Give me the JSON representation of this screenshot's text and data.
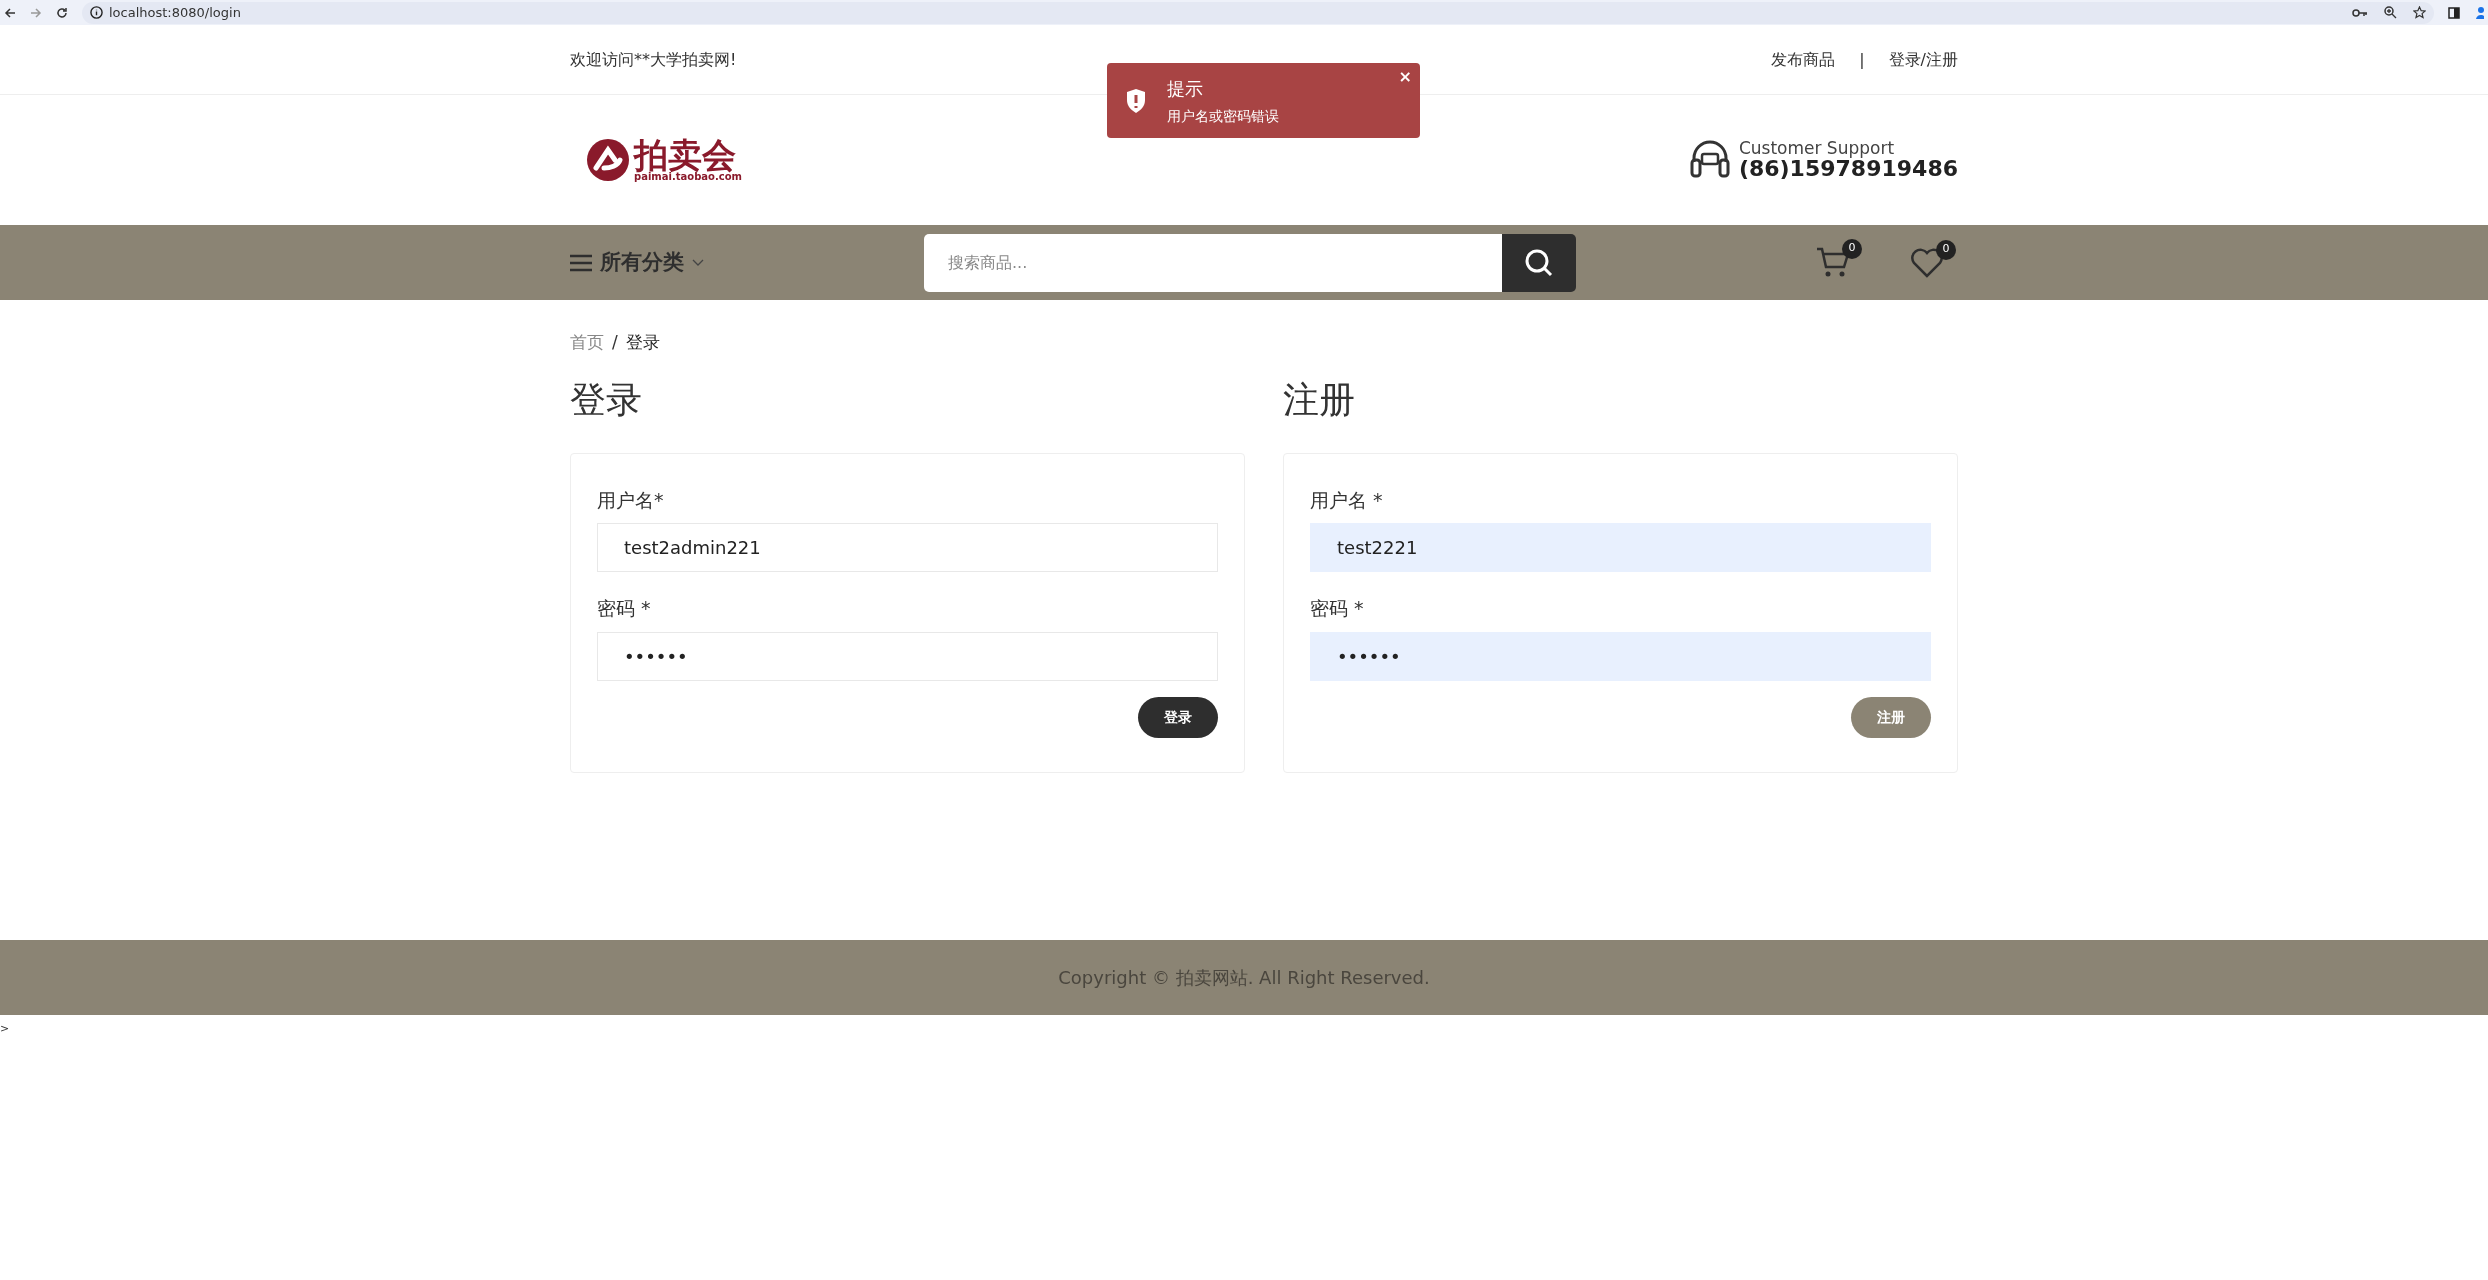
{
  "browser": {
    "url": "localhost:8080/login"
  },
  "top_bar": {
    "welcome": "欢迎访问**大学拍卖网!",
    "links": [
      {
        "label": "发布商品"
      },
      {
        "label": "登录/注册"
      }
    ],
    "separator": "|"
  },
  "toast": {
    "title": "提示",
    "message": "用户名或密码错误",
    "close": "×"
  },
  "header": {
    "logo": {
      "name": "拍卖会",
      "domain": "paimai.taobao.com"
    },
    "support": {
      "label": "Customer Support",
      "phone": "(86)15978919486"
    }
  },
  "nav": {
    "menu_label": "所有分类",
    "search": {
      "placeholder": "搜索商品..."
    },
    "cart_count": "0",
    "wishlist_count": "0"
  },
  "breadcrumb": [
    {
      "label": "首页",
      "selected": false
    },
    {
      "label": "登录",
      "selected": true
    }
  ],
  "breadcrumb_separator": "/",
  "forms": [
    {
      "title": "登录",
      "fields": [
        {
          "label": "用户名*",
          "value": "test2admin221",
          "autofilled": false
        },
        {
          "label": "密码 *",
          "value": "••••••",
          "autofilled": false
        }
      ],
      "button": {
        "label": "登录",
        "hovered": true
      }
    },
    {
      "title": "注册",
      "fields": [
        {
          "label": "用户名 *",
          "value": "test2221",
          "autofilled": true
        },
        {
          "label": "密码 *",
          "value": "••••••",
          "autofilled": true
        }
      ],
      "button": {
        "label": "注册",
        "hovered": false
      }
    }
  ],
  "footer": {
    "copyright": "Copyright © 拍卖网站. All Right Reserved."
  },
  "stray_text": ">"
}
